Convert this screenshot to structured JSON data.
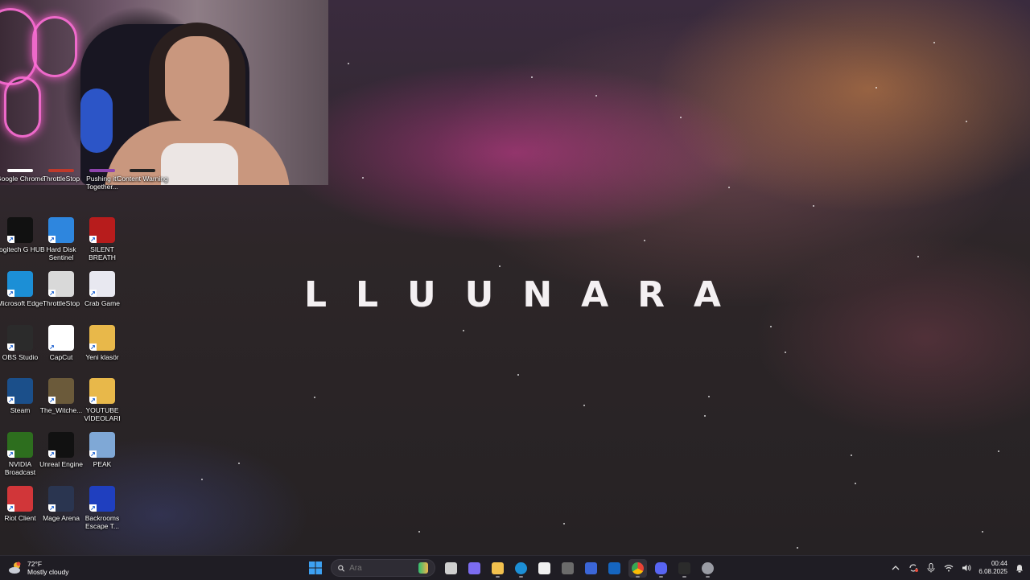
{
  "wallpaper": {
    "brand_letters": [
      "L",
      "L",
      "U",
      "U",
      "N",
      "A",
      "R",
      "A"
    ]
  },
  "desktop_icons": [
    {
      "id": "chrome",
      "label": "Google Chrome",
      "icon": "chrome-icon",
      "color": "#ffffff"
    },
    {
      "id": "throttlestop1",
      "label": "ThrottleStop",
      "icon": "throttlestop-icon",
      "color": "#c0392b"
    },
    {
      "id": "pushingit",
      "label": "Pushing it! Together...",
      "icon": "game-icon",
      "color": "#8e44ad"
    },
    {
      "id": "contentwarning",
      "label": "Content Warning",
      "icon": "game-icon",
      "color": "#222222"
    },
    {
      "id": "logitech",
      "label": "Logitech G HUB",
      "icon": "logitech-icon",
      "color": "#111111"
    },
    {
      "id": "hdsentinel",
      "label": "Hard Disk Sentinel",
      "icon": "disk-icon",
      "color": "#2e86de"
    },
    {
      "id": "silentbreath",
      "label": "SILENT BREATH",
      "icon": "game-icon",
      "color": "#b71c1c"
    },
    {
      "id": "edge",
      "label": "Microsoft Edge",
      "icon": "edge-icon",
      "color": "#1c8fd6"
    },
    {
      "id": "throttlestop2",
      "label": "ThrottleStop",
      "icon": "file-icon",
      "color": "#d9d9d9"
    },
    {
      "id": "crabgame",
      "label": "Crab Game",
      "icon": "game-icon",
      "color": "#e8e8f0"
    },
    {
      "id": "obs",
      "label": "OBS Studio",
      "icon": "obs-icon",
      "color": "#2b2b2b"
    },
    {
      "id": "capcut",
      "label": "CapCut",
      "icon": "capcut-icon",
      "color": "#ffffff"
    },
    {
      "id": "yeniklasor",
      "label": "Yeni klasör",
      "icon": "folder-icon",
      "color": "#e8b84a"
    },
    {
      "id": "steam",
      "label": "Steam",
      "icon": "steam-icon",
      "color": "#1b4f8a"
    },
    {
      "id": "witcher",
      "label": "The_Witche...",
      "icon": "game-icon",
      "color": "#6b5a3a"
    },
    {
      "id": "youtubevideos",
      "label": "YOUTUBE VİDEOLARI",
      "icon": "folder-icon",
      "color": "#e8b84a"
    },
    {
      "id": "nvidia",
      "label": "NVIDIA Broadcast",
      "icon": "nvidia-icon",
      "color": "#2d6e1e"
    },
    {
      "id": "unreal",
      "label": "Unreal Engine",
      "icon": "unreal-icon",
      "color": "#111111"
    },
    {
      "id": "peak",
      "label": "PEAK",
      "icon": "game-icon",
      "color": "#7fa8d6"
    },
    {
      "id": "riot",
      "label": "Riot Client",
      "icon": "riot-icon",
      "color": "#d13639"
    },
    {
      "id": "magearena",
      "label": "Mage Arena",
      "icon": "game-icon",
      "color": "#2a3550"
    },
    {
      "id": "backrooms",
      "label": "Backrooms Escape T...",
      "icon": "game-icon",
      "color": "#1f3fbf"
    }
  ],
  "taskbar": {
    "weather": {
      "temp": "72°F",
      "condition": "Mostly cloudy",
      "icon": "cloudy-weather-icon"
    },
    "search": {
      "placeholder": "Ara"
    },
    "apps": [
      {
        "name": "task-view",
        "icon": "task-view-icon",
        "color": "#cfcfcf"
      },
      {
        "name": "copilot",
        "icon": "copilot-icon",
        "color": "#7c6cf0"
      },
      {
        "name": "file-explorer",
        "icon": "folder-icon",
        "color": "#f2c14e"
      },
      {
        "name": "edge",
        "icon": "edge-icon",
        "color": "#1c8fd6"
      },
      {
        "name": "store",
        "icon": "store-icon",
        "color": "#f0f0f0"
      },
      {
        "name": "app-hex",
        "icon": "hexagon-icon",
        "color": "#6b6b6b"
      },
      {
        "name": "app-blue",
        "icon": "app-icon",
        "color": "#3b66d8"
      },
      {
        "name": "outlook",
        "icon": "outlook-icon",
        "color": "#1565c0"
      },
      {
        "name": "chrome",
        "icon": "chrome-icon",
        "color": "#ffffff"
      },
      {
        "name": "discord",
        "icon": "discord-icon",
        "color": "#5865f2"
      },
      {
        "name": "obs",
        "icon": "obs-icon",
        "color": "#2b2b2b"
      },
      {
        "name": "settings",
        "icon": "gear-icon",
        "color": "#9a9ca4"
      }
    ],
    "tray": {
      "clock_time": "00:44",
      "clock_date": "6.08.2025"
    }
  }
}
